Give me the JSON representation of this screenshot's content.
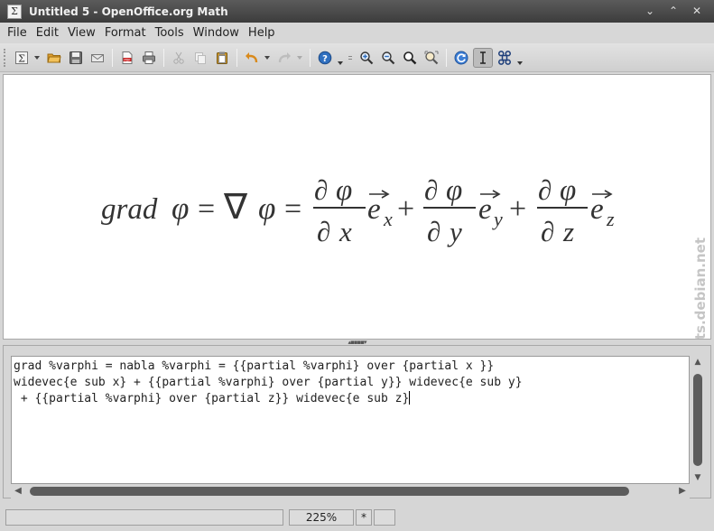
{
  "window": {
    "title": "Untitled 5 - OpenOffice.org Math",
    "app_icon_glyph": "Σ",
    "controls": {
      "minimize": "⌄",
      "maximize": "⌃",
      "close": "✕"
    }
  },
  "menubar": {
    "items": [
      {
        "label": "File"
      },
      {
        "label": "Edit"
      },
      {
        "label": "View"
      },
      {
        "label": "Format"
      },
      {
        "label": "Tools"
      },
      {
        "label": "Window"
      },
      {
        "label": "Help"
      }
    ]
  },
  "toolbar": {
    "icons": [
      "sigma-icon",
      "open-icon",
      "save-icon",
      "email-icon",
      "export-pdf-icon",
      "print-icon",
      "cut-icon",
      "copy-icon",
      "paste-icon",
      "undo-icon",
      "redo-icon",
      "help-icon",
      "zoom-in-icon",
      "zoom-out-icon",
      "zoom-100-icon",
      "show-all-icon",
      "update-icon",
      "formula-cursor-icon",
      "symbols-icon"
    ],
    "pdf_glyph": "PDF"
  },
  "formula": {
    "text_grad": "grad",
    "phi": "φ",
    "equals": "=",
    "nabla": "∇",
    "partial": "∂",
    "plus": "+",
    "e": "e",
    "x": "x",
    "y": "y",
    "z": "z"
  },
  "watermark": "screenshots.debian.net",
  "editor": {
    "lines": [
      "grad %varphi = nabla %varphi = {{partial %varphi} over {partial x }}",
      "widevec{e sub x} + {{partial %varphi} over {partial y}} widevec{e sub y}",
      " + {{partial %varphi} over {partial z}} widevec{e sub z}"
    ]
  },
  "statusbar": {
    "main": "",
    "zoom": "225%",
    "modified": "*",
    "signature": ""
  },
  "colors": {
    "titlebar": "#4a4a4a",
    "chrome": "#d6d6d6",
    "canvas": "#ffffff",
    "scroll_thumb": "#5c5c5c"
  }
}
